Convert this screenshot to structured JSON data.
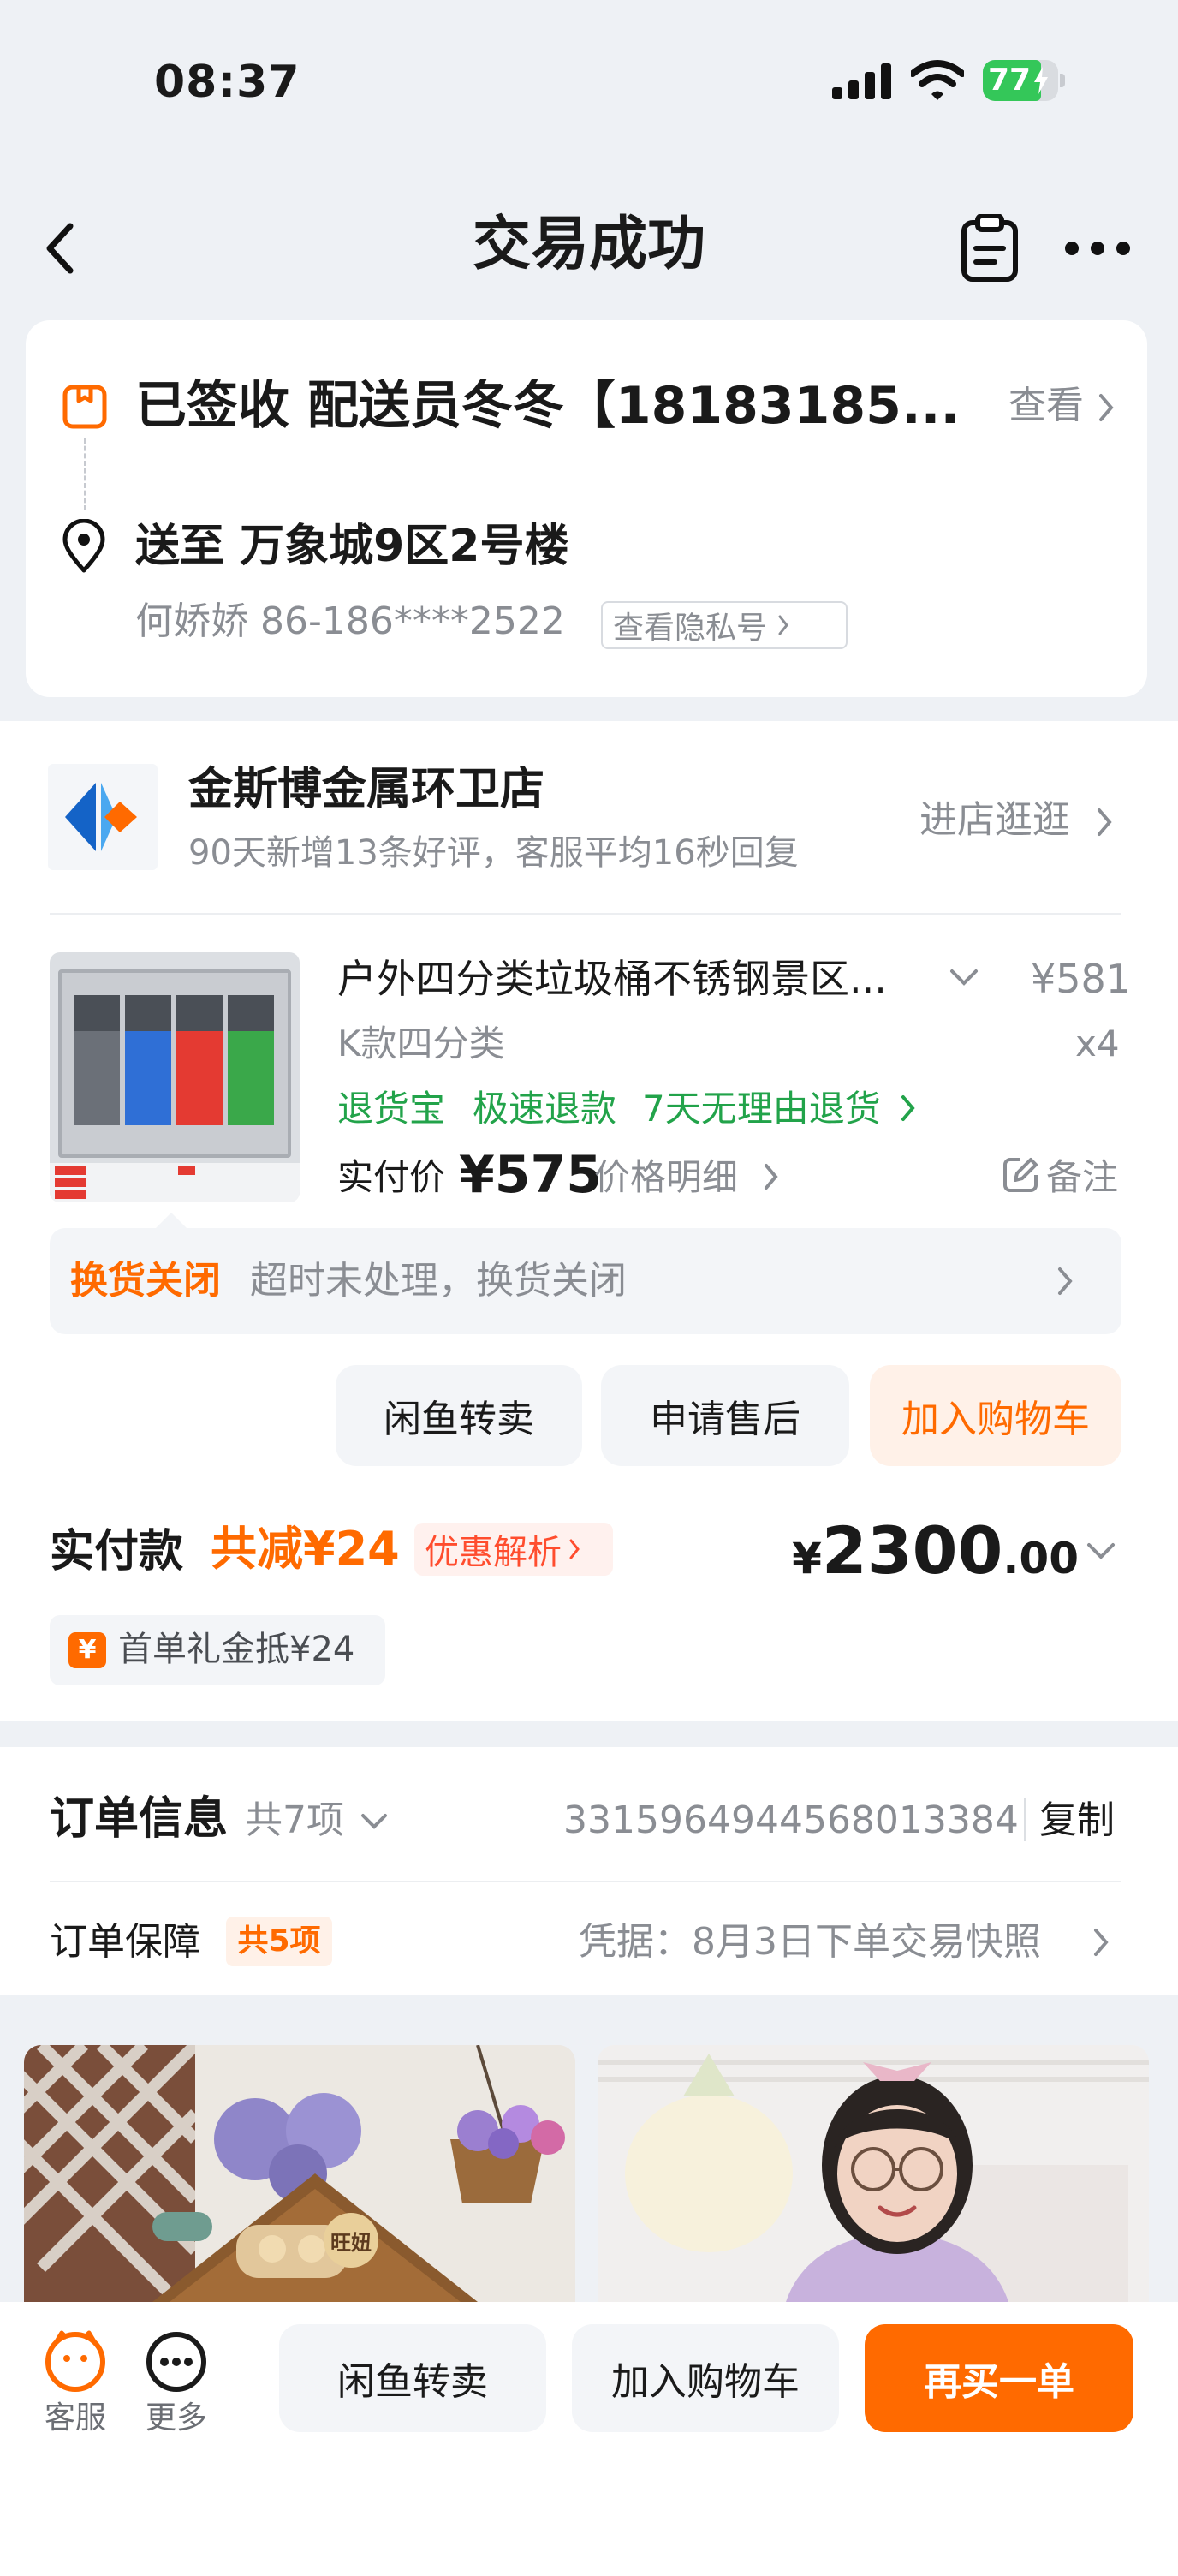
{
  "status_bar": {
    "time": "08:37",
    "battery": "77"
  },
  "nav": {
    "title": "交易成功"
  },
  "delivery": {
    "status": "已签收 配送员冬冬【18183185...",
    "view": "查看",
    "address": "送至 万象城9区2号楼",
    "contact": "何娇娇 86-186****2522",
    "privacy_button": "查看隐私号"
  },
  "shop": {
    "name": "金斯博金属环卫店",
    "subtitle": "90天新增13条好评，客服平均16秒回复",
    "enter": "进店逛逛"
  },
  "product": {
    "title": "户外四分类垃圾桶不锈钢景区...",
    "price": "¥581",
    "spec": "K款四分类",
    "qty": "x4",
    "tags": [
      "退货宝",
      "极速退款",
      "7天无理由退货"
    ],
    "paid_label": "实付价",
    "paid_value": "¥575",
    "price_detail": "价格明细",
    "note": "备注"
  },
  "exchange": {
    "label": "换货关闭",
    "text": "超时未处理，换货关闭"
  },
  "item_actions": {
    "resell": "闲鱼转卖",
    "after_sale": "申请售后",
    "add_cart": "加入购物车"
  },
  "payment": {
    "label": "实付款",
    "discount": "共减¥24",
    "discount_detail": "优惠解析",
    "total_symbol": "¥",
    "total_int": "2300",
    "total_dec": ".00",
    "coupon_icon": "¥",
    "coupon": "首单礼金抵¥24"
  },
  "order_info": {
    "label": "订单信息",
    "count": "共7项",
    "number": "3315964944568013384",
    "copy": "复制",
    "guarantee_label": "订单保障",
    "guarantee_count": "共5项",
    "snapshot": "凭据：8月3日下单交易快照"
  },
  "recommend": {
    "sign_text": "旺妞"
  },
  "bottom_bar": {
    "service": "客服",
    "more": "更多",
    "resell": "闲鱼转卖",
    "add_cart": "加入购物车",
    "rebuy": "再买一单"
  },
  "colors": {
    "accent": "#ff6a00",
    "green": "#22a34a",
    "bg": "#eef1f5"
  }
}
